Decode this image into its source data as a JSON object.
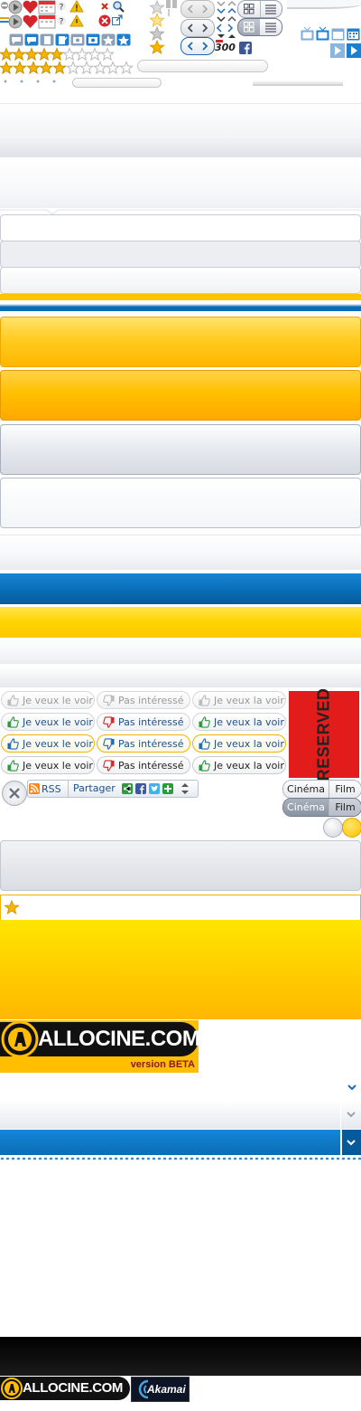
{
  "header_numbers": {
    "count": "300"
  },
  "like_rows": [
    {
      "style": "disabled",
      "want": "Je veux le voir",
      "not": "Pas intéressé",
      "want_f": "Je veux la voir"
    },
    {
      "style": "normal",
      "want": "Je veux le voir",
      "not": "Pas intéressé",
      "want_f": "Je veux la voir"
    },
    {
      "style": "hover",
      "want": "Je veux le voir",
      "not": "Pas intéressé",
      "want_f": "Je veux la voir"
    },
    {
      "style": "active",
      "want": "Je veux le voir",
      "not": "Pas intéressé",
      "want_f": "Je veux la voir"
    }
  ],
  "reserved_label": "RESERVED",
  "share": {
    "rss": "RSS",
    "partager": "Partager"
  },
  "tabs": [
    {
      "left": "Cinéma",
      "right": "Film",
      "state": "light"
    },
    {
      "left": "Cinéma",
      "right": "Film",
      "state": "dark"
    }
  ],
  "logo": {
    "brand": "ALLOCINE.COM",
    "beta": "version BETA",
    "brand_small": "ALLOCINE.COM",
    "partner": "Akamai"
  },
  "colors": {
    "blue": "#0a6db6",
    "yellow": "#ffc400",
    "gold": "#ffb600",
    "grey_border": "#c9ccd4"
  }
}
